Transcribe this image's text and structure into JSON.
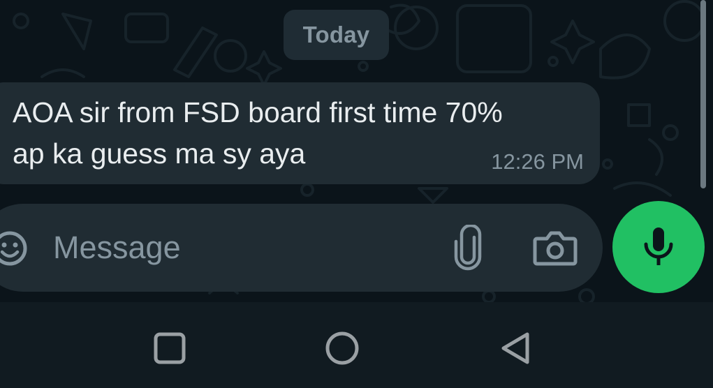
{
  "date_chip": {
    "label": "Today"
  },
  "message": {
    "text_line1": "AOA sir from FSD board first time 70%",
    "text_line2": "ap ka guess ma sy aya",
    "time": "12:26 PM"
  },
  "composer": {
    "placeholder": "Message",
    "emoji_icon": "emoji-icon",
    "attach_icon": "paperclip-icon",
    "camera_icon": "camera-icon",
    "mic_icon": "microphone-icon"
  },
  "navigation": {
    "recents_icon": "square-icon",
    "home_icon": "circle-icon",
    "back_icon": "triangle-back-icon"
  },
  "colors": {
    "background": "#0b141a",
    "bubble": "#202c33",
    "accent_green": "#21c063",
    "text_primary": "#e9edef",
    "text_secondary": "#8696a0"
  }
}
